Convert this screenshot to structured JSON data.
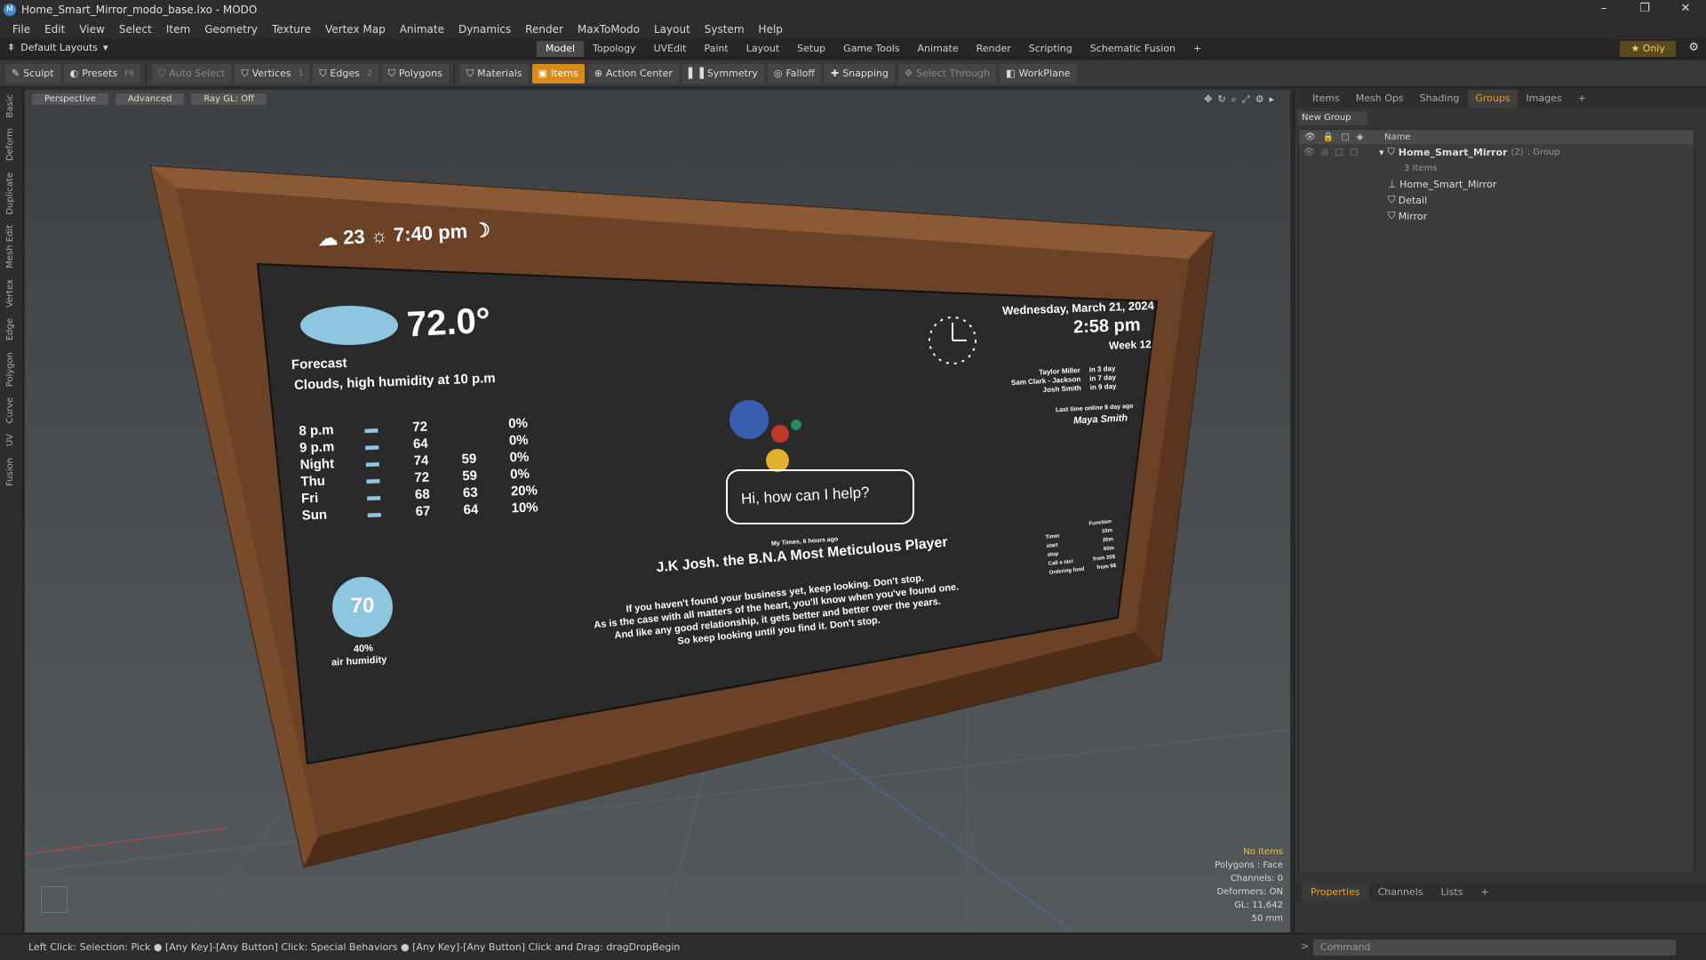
{
  "window": {
    "title": "Home_Smart_Mirror_modo_base.lxo - MODO",
    "min": "–",
    "max": "❐",
    "close": "✕"
  },
  "menu": [
    "File",
    "Edit",
    "View",
    "Select",
    "Item",
    "Geometry",
    "Texture",
    "Vertex Map",
    "Animate",
    "Dynamics",
    "Render",
    "MaxToModo",
    "Layout",
    "System",
    "Help"
  ],
  "layout": {
    "label": "Default Layouts",
    "only_label": "Only"
  },
  "mode_tabs": [
    {
      "label": "Model",
      "active": true
    },
    {
      "label": "Topology"
    },
    {
      "label": "UVEdit"
    },
    {
      "label": "Paint"
    },
    {
      "label": "Layout"
    },
    {
      "label": "Setup"
    },
    {
      "label": "Game Tools"
    },
    {
      "label": "Animate"
    },
    {
      "label": "Render"
    },
    {
      "label": "Scripting"
    },
    {
      "label": "Schematic Fusion"
    },
    {
      "label": "+"
    }
  ],
  "toolbar": {
    "sculpt": "Sculpt",
    "presets": "Presets",
    "presets_key": "F6",
    "auto_select": "Auto Select",
    "vertices": "Vertices",
    "vertices_key": "1",
    "edges": "Edges",
    "edges_key": "2",
    "polygons": "Polygons",
    "materials": "Materials",
    "items": "Items",
    "action_center": "Action Center",
    "symmetry": "Symmetry",
    "falloff": "Falloff",
    "snapping": "Snapping",
    "select_through": "Select Through",
    "workplane": "WorkPlane"
  },
  "left_tabs": [
    "Basic",
    "Deform",
    "Duplicate",
    "Mesh Edit",
    "Vertex",
    "Edge",
    "Polygon",
    "Curve",
    "UV",
    "Fusion"
  ],
  "viewport": {
    "view_btn": "Perspective",
    "shading_btn": "Advanced",
    "raygl_btn": "Ray GL: Off",
    "stats": {
      "no_items": "No Items",
      "polygons": "Polygons : Face",
      "channels": "Channels: 0",
      "deformers": "Deformers: ON",
      "gl": "GL: 11,642",
      "scale": "50 mm"
    }
  },
  "mirror_screen": {
    "top_temp": "23",
    "time": "7:40 pm",
    "temp": "72.0°",
    "forecast_label": "Forecast",
    "forecast_text": "Clouds, high humidity at 10 p.m",
    "rows": [
      {
        "t": "8 p.m",
        "a": "72",
        "b": "",
        "p": "0%"
      },
      {
        "t": "9 p.m",
        "a": "64",
        "b": "",
        "p": "0%"
      },
      {
        "t": "Night",
        "a": "74",
        "b": "59",
        "p": "0%"
      },
      {
        "t": "Thu",
        "a": "72",
        "b": "59",
        "p": "0%"
      },
      {
        "t": "Fri",
        "a": "68",
        "b": "63",
        "p": "20%"
      },
      {
        "t": "Sun",
        "a": "67",
        "b": "64",
        "p": "10%"
      }
    ],
    "humidity_value": "70",
    "humidity_pct": "40%",
    "humidity_label": "air humidity",
    "date": "Wednesday, March 21, 2024",
    "clock": "2:58 pm",
    "week": "Week 12",
    "contacts": [
      {
        "n": "Taylor Miller",
        "d": "in 3 day"
      },
      {
        "n": "Sam Clark - Jackson",
        "d": "in 7 day"
      },
      {
        "n": "Josh Smith",
        "d": "in 9 day"
      }
    ],
    "last_online": "Last time online 8 day ago",
    "last_name": "Maya Smith",
    "assistant": "Hi, how can I help?",
    "news_source": "My Times, 6 hours ago",
    "headline": "J.K Josh. the B.N.A Most Meticulous Player",
    "quote": [
      "If you haven't found your business yet, keep looking. Don't stop.",
      "As is the case with all matters of the heart, you'll know when you've found one.",
      "And like any good relationship, it gets better and better over the years.",
      "So keep looking until you find it. Don't stop."
    ],
    "side_title": "Function",
    "side": [
      {
        "l": "Timer",
        "v": "10m"
      },
      {
        "l": "start",
        "v": "20m"
      },
      {
        "l": "stop",
        "v": "60m"
      },
      {
        "l": "Call a taxi",
        "v": "from 20$"
      },
      {
        "l": "Ordering food",
        "v": "from 9$"
      }
    ]
  },
  "right_panel": {
    "tabs": [
      {
        "label": "Items"
      },
      {
        "label": "Mesh Ops"
      },
      {
        "label": "Shading"
      },
      {
        "label": "Groups",
        "active": true
      },
      {
        "label": "Images"
      },
      {
        "label": "+"
      }
    ],
    "new_group": "New Group",
    "name_col": "Name",
    "group": {
      "name": "Home_Smart_Mirror",
      "count": "(2)",
      "type": ": Group",
      "sub": "3 Items"
    },
    "children": [
      "Home_Smart_Mirror",
      "Detail",
      "Mirror"
    ],
    "bottom_tabs": [
      {
        "label": "Properties",
        "active": true
      },
      {
        "label": "Channels"
      },
      {
        "label": "Lists"
      },
      {
        "label": "+"
      }
    ]
  },
  "status": {
    "text": "Left Click: Selection: Pick ● [Any Key]-[Any Button] Click: Special Behaviors ● [Any Key]-[Any Button] Click and Drag: dragDropBegin"
  },
  "command": {
    "placeholder": "Command"
  }
}
